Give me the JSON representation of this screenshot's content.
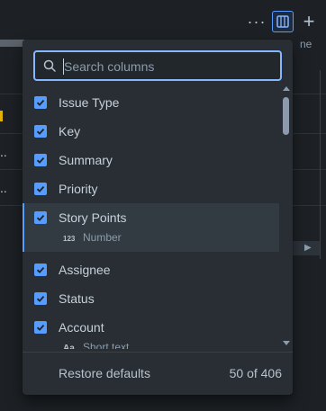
{
  "toolbar": {
    "more_icon": "more-icon",
    "columns_icon": "columns-icon",
    "add_icon": "plus-icon"
  },
  "background": {
    "header_fragment": "ne",
    "row_fragments": [
      "..",
      ".."
    ]
  },
  "search": {
    "placeholder": "Search columns",
    "value": ""
  },
  "columns": [
    {
      "label": "Issue Type",
      "checked": true
    },
    {
      "label": "Key",
      "checked": true
    },
    {
      "label": "Summary",
      "checked": true
    },
    {
      "label": "Priority",
      "checked": true
    },
    {
      "label": "Story Points",
      "checked": true,
      "type_icon": "123",
      "type": "Number",
      "highlighted": true
    },
    {
      "label": "Assignee",
      "checked": true
    },
    {
      "label": "Status",
      "checked": true
    },
    {
      "label": "Account",
      "checked": true,
      "type_icon": "Aa",
      "type": "Short text"
    }
  ],
  "footer": {
    "restore_label": "Restore defaults",
    "count": "50 of 406"
  },
  "colors": {
    "accent": "#579dff",
    "popup_bg": "#282e33",
    "page_bg": "#1d2125"
  }
}
